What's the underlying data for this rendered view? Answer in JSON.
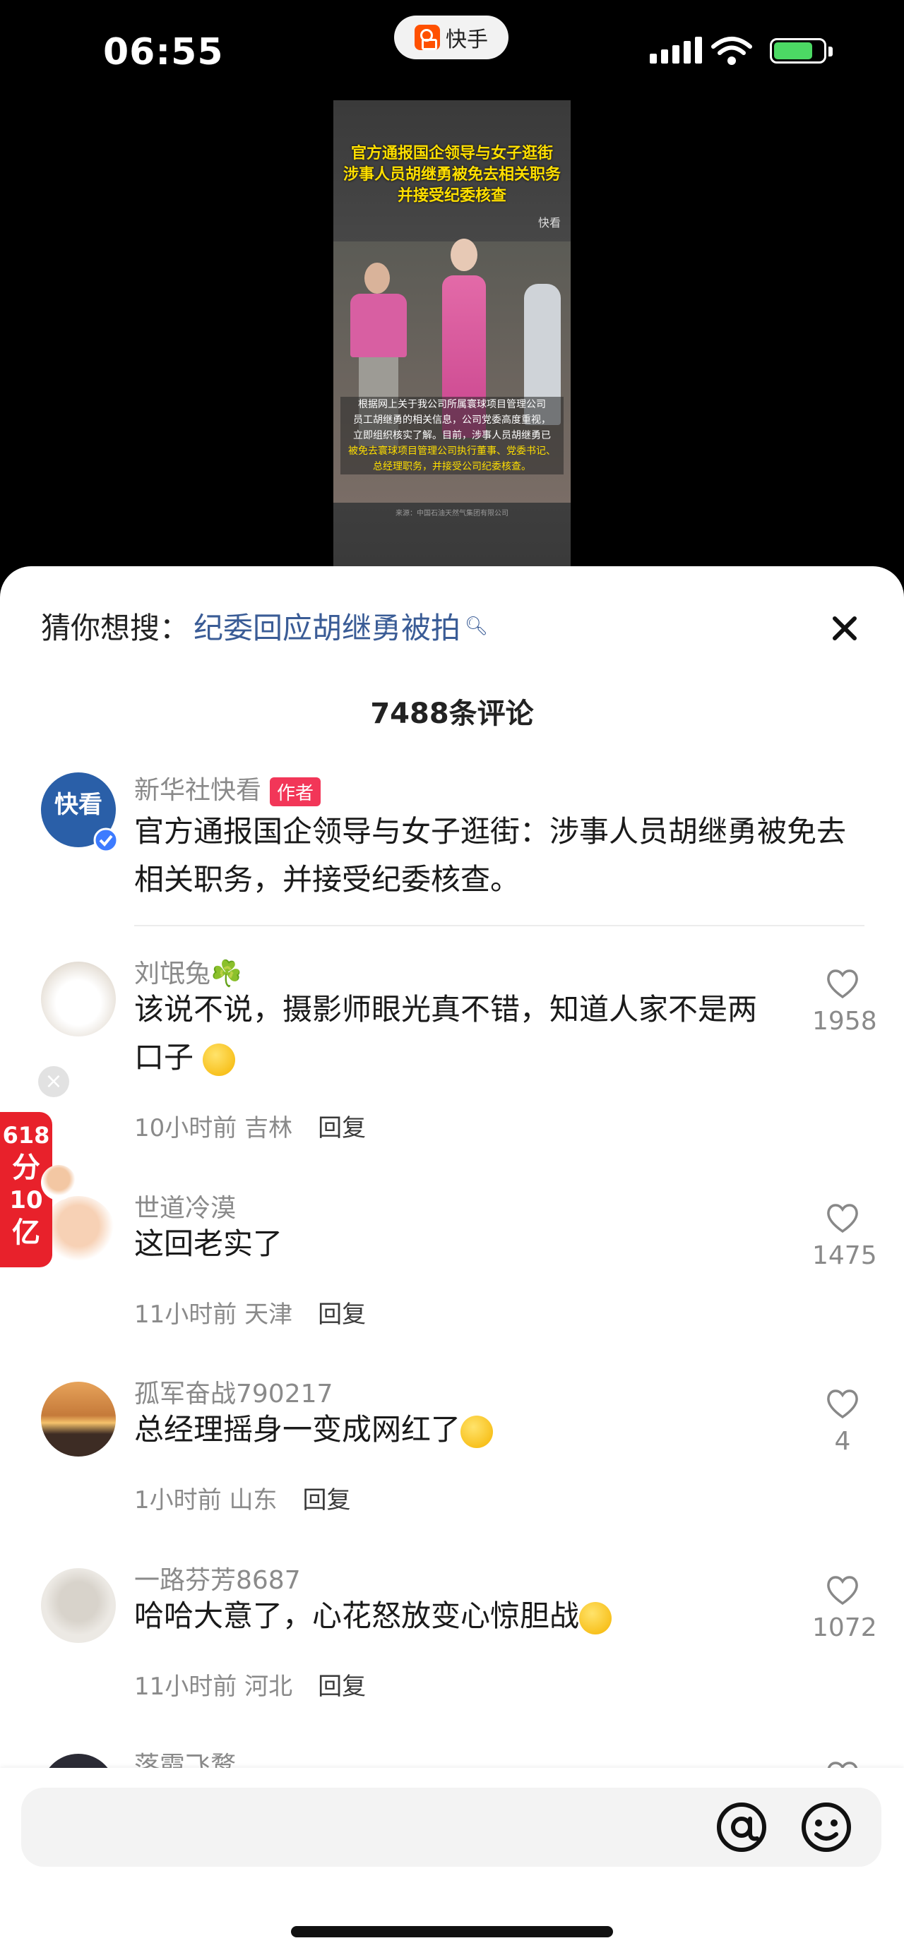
{
  "status_bar": {
    "time": "06:55",
    "app_name": "快手"
  },
  "video": {
    "headline_lines": [
      "官方通报国企领导与女子逛街",
      "涉事人员胡继勇被免去相关职务",
      "并接受纪委核查"
    ],
    "watermark": "快看",
    "body_lines": [
      "根据网上关于我公司所属寰球项目管理公司",
      "员工胡继勇的相关信息，公司党委高度重视，",
      "立即组织核实了解。目前，涉事人员胡继勇已",
      "被免去寰球项目管理公司执行董事、党委书记、",
      "总经理职务，并接受公司纪委核查。"
    ],
    "source": "来源：中国石油天然气集团有限公司"
  },
  "sheet": {
    "search_prefix": "猜你想搜：",
    "search_keyword": "纪委回应胡继勇被拍",
    "comment_count": "7488条评论",
    "author_post": {
      "name": "新华社快看",
      "tag": "作者",
      "text": "官方通报国企领导与女子逛街：涉事人员胡继勇被免去相关职务，并接受纪委核查。"
    },
    "comments": [
      {
        "name": "刘氓兔☘️",
        "text": "该说不说，摄影师眼光真不错，知道人家不是两口子",
        "time": "10小时前",
        "location": "吉林",
        "reply": "回复",
        "likes": "1958"
      },
      {
        "name": "世道冷漠",
        "text": "这回老实了",
        "time": "11小时前",
        "location": "天津",
        "reply": "回复",
        "likes": "1475"
      },
      {
        "name": "孤军奋战790217",
        "text": "总经理摇身一变成网红了",
        "time": "1小时前",
        "location": "山东",
        "reply": "回复",
        "likes": "4"
      },
      {
        "name": "一路芬芳8687",
        "text": "哈哈大意了，心花怒放变心惊胆战",
        "time": "11小时前",
        "location": "河北",
        "reply": "回复",
        "likes": "1072"
      },
      {
        "name": "落霞飞鹜"
      }
    ],
    "promo_badge": [
      "618",
      "分",
      "10",
      "亿"
    ]
  },
  "colors": {
    "accent_link": "#3a5c96",
    "author_tag": "#f23658",
    "promo": "#e8212b"
  }
}
